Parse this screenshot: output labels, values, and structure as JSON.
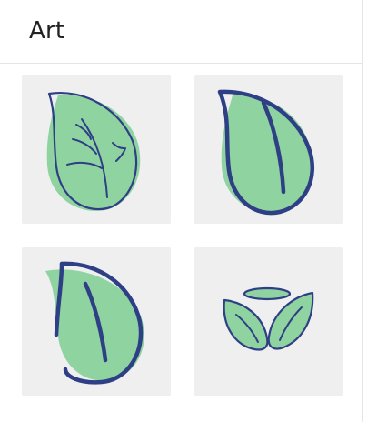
{
  "panel": {
    "title": "Art"
  },
  "colors": {
    "tile_background": "#efeff0",
    "leaf_fill": "#8fd3a0",
    "leaf_stroke": "#2e3f86",
    "divider": "#e4e4e4"
  },
  "stickers": [
    {
      "name": "leaf-sticker-veined",
      "icon": "leaf-icon"
    },
    {
      "name": "leaf-sticker-bold-outline",
      "icon": "leaf-icon"
    },
    {
      "name": "leaf-sticker-offset-outline",
      "icon": "leaf-icon"
    },
    {
      "name": "sprout-sticker",
      "icon": "sprout-icon"
    }
  ]
}
